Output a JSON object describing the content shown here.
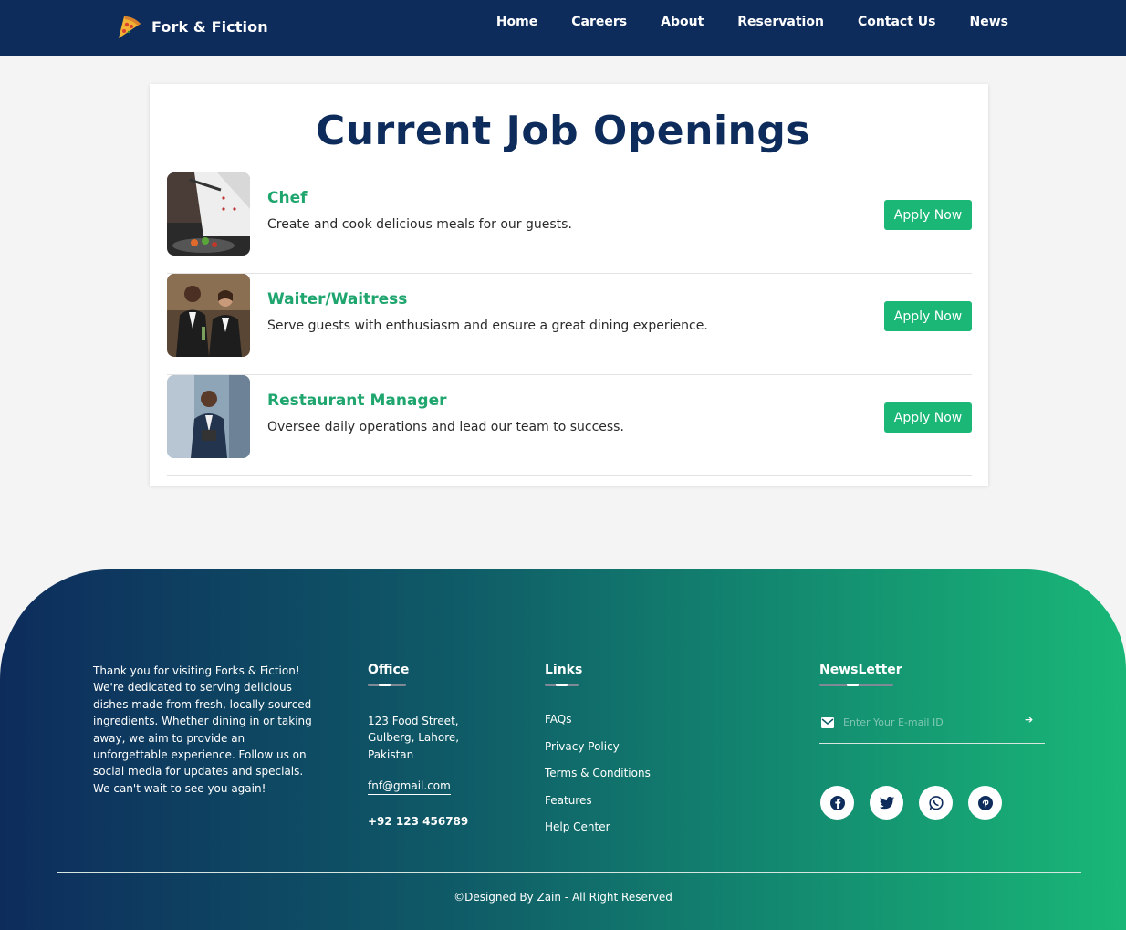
{
  "nav": {
    "brand": "Fork & Fiction",
    "links": [
      "Home",
      "Careers",
      "About",
      "Reservation",
      "Contact Us",
      "News"
    ]
  },
  "main": {
    "title": "Current Job Openings",
    "jobs": [
      {
        "title": "Chef",
        "description": "Create and cook delicious meals for our guests.",
        "button": "Apply Now"
      },
      {
        "title": "Waiter/Waitress",
        "description": "Serve guests with enthusiasm and ensure a great dining experience.",
        "button": "Apply Now"
      },
      {
        "title": "Restaurant Manager",
        "description": "Oversee daily operations and lead our team to success.",
        "button": "Apply Now"
      }
    ]
  },
  "footer": {
    "about": "Thank you for visiting Forks & Fiction! We're dedicated to serving delicious dishes made from fresh, locally sourced ingredients. Whether dining in or taking away, we aim to provide an unforgettable experience. Follow us on social media for updates and specials. We can't wait to see you again!",
    "office": {
      "heading": "Office",
      "address": "123 Food Street, Gulberg, Lahore, Pakistan",
      "email": "fnf@gmail.com",
      "phone": "+92 123 456789"
    },
    "links": {
      "heading": "Links",
      "items": [
        "FAQs",
        "Privacy Policy",
        "Terms & Conditions",
        "Features",
        "Help Center"
      ]
    },
    "newsletter": {
      "heading": "NewsLetter",
      "placeholder": "Enter Your E-mail ID"
    },
    "socials": [
      "facebook-icon",
      "twitter-icon",
      "whatsapp-icon",
      "pinterest-icon"
    ],
    "copyright": "©Designed By Zain - All Right Reserved"
  },
  "colors": {
    "navy": "#0d2c5c",
    "green": "#1ab777",
    "job_title": "#1fa56e"
  }
}
